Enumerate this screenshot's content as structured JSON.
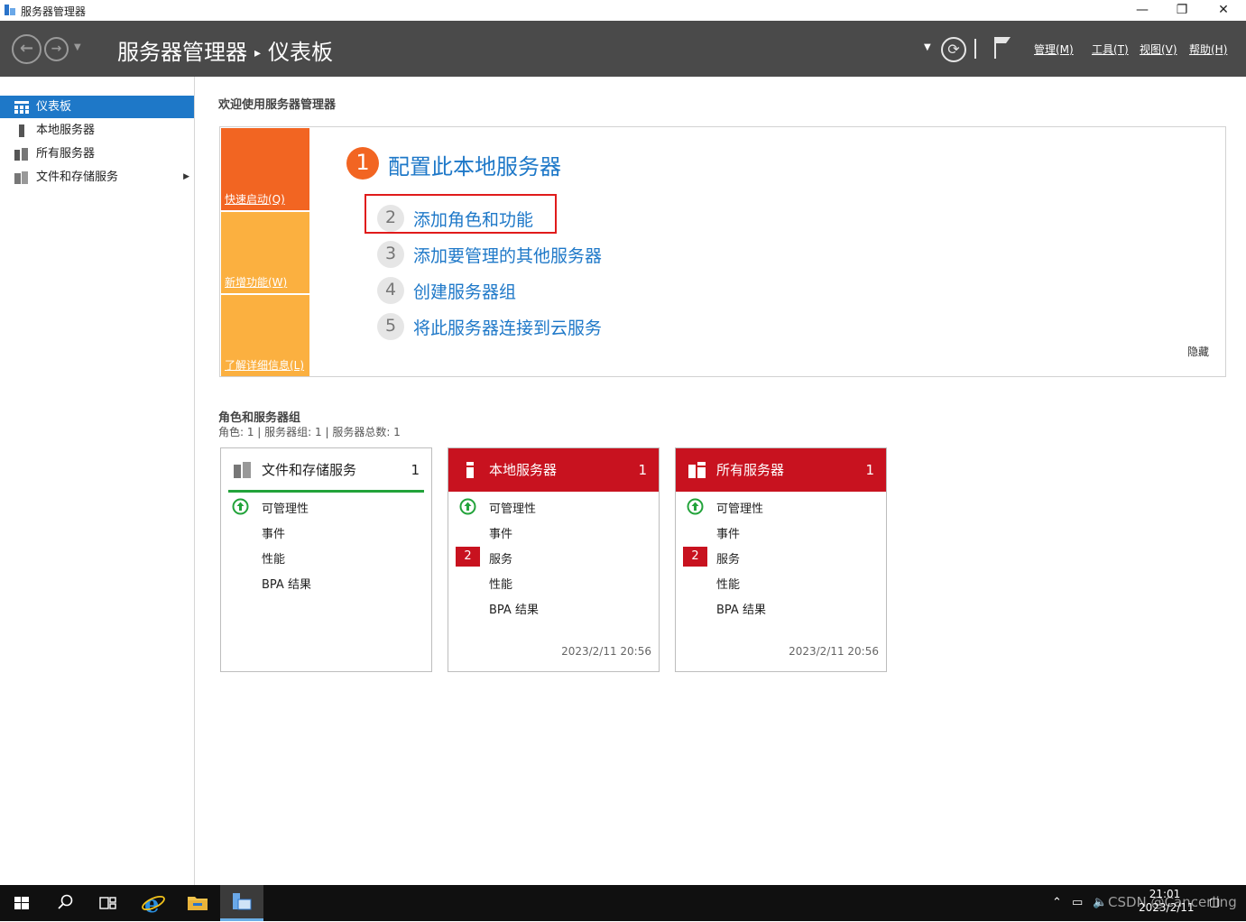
{
  "window": {
    "title": "服务器管理器",
    "controls": {
      "minimize": "—",
      "restore": "❐",
      "close": "✕"
    }
  },
  "header": {
    "breadcrumb": [
      "服务器管理器",
      "仪表板"
    ],
    "breadcrumb_sep": "▸",
    "menus": [
      "管理(M)",
      "工具(T)",
      "视图(V)",
      "帮助(H)"
    ]
  },
  "sidebar": {
    "items": [
      {
        "label": "仪表板",
        "active": true
      },
      {
        "label": "本地服务器"
      },
      {
        "label": "所有服务器"
      },
      {
        "label": "文件和存储服务",
        "has_submenu": true
      }
    ]
  },
  "welcome": {
    "heading": "欢迎使用服务器管理器",
    "tiles": [
      {
        "label": "快速启动(Q)",
        "color": "#f26522"
      },
      {
        "label": "新增功能(W)",
        "color": "#fbb040"
      },
      {
        "label": "了解详细信息(L)",
        "color": "#fbb040"
      }
    ],
    "steps": [
      {
        "num": "1",
        "label": "配置此本地服务器"
      },
      {
        "num": "2",
        "label": "添加角色和功能"
      },
      {
        "num": "3",
        "label": "添加要管理的其他服务器"
      },
      {
        "num": "4",
        "label": "创建服务器组"
      },
      {
        "num": "5",
        "label": "将此服务器连接到云服务"
      }
    ],
    "hide_label": "隐藏"
  },
  "roles": {
    "heading": "角色和服务器组",
    "summary": "角色: 1 | 服务器组: 1 | 服务器总数: 1",
    "cards": [
      {
        "title": "文件和存储服务",
        "count": "1",
        "status": "ok",
        "rows": [
          "可管理性",
          "事件",
          "性能",
          "BPA 结果"
        ],
        "timestamp": ""
      },
      {
        "title": "本地服务器",
        "count": "1",
        "status": "alert",
        "rows": [
          "可管理性",
          "事件",
          "服务",
          "性能",
          "BPA 结果"
        ],
        "services_badge": "2",
        "timestamp": "2023/2/11 20:56"
      },
      {
        "title": "所有服务器",
        "count": "1",
        "status": "alert",
        "rows": [
          "可管理性",
          "事件",
          "服务",
          "性能",
          "BPA 结果"
        ],
        "services_badge": "2",
        "timestamp": "2023/2/11 20:56"
      }
    ]
  },
  "taskbar": {
    "time": "21:01",
    "date": "2023/2/11",
    "watermark": "CSDN @Cancerling"
  },
  "colors": {
    "accent": "#1e78c8",
    "alert": "#c8121f",
    "ok": "#22a33a",
    "quickstart": "#f26522",
    "tile": "#fbb040",
    "header": "#4a4a4a"
  }
}
